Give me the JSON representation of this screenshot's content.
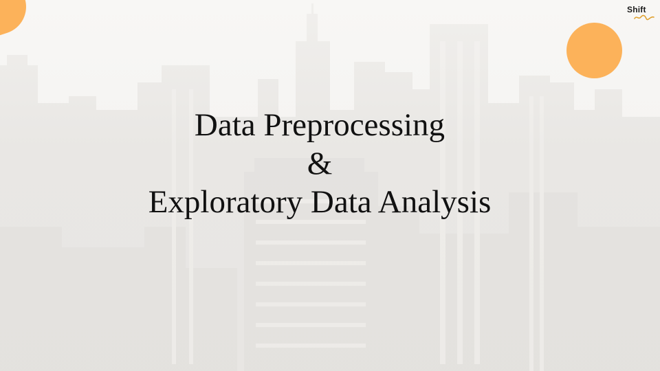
{
  "slide": {
    "title_lines": [
      "Data Preprocessing",
      "&",
      "Exploratory Data Analysis"
    ],
    "logo_text": "Shift",
    "logo_icon": "shift-academy-logo-icon",
    "background_icon": "city-skyline-photo",
    "colors": {
      "accent": "#fcb25a",
      "text": "#111111",
      "background": "#f3f2f0"
    }
  }
}
